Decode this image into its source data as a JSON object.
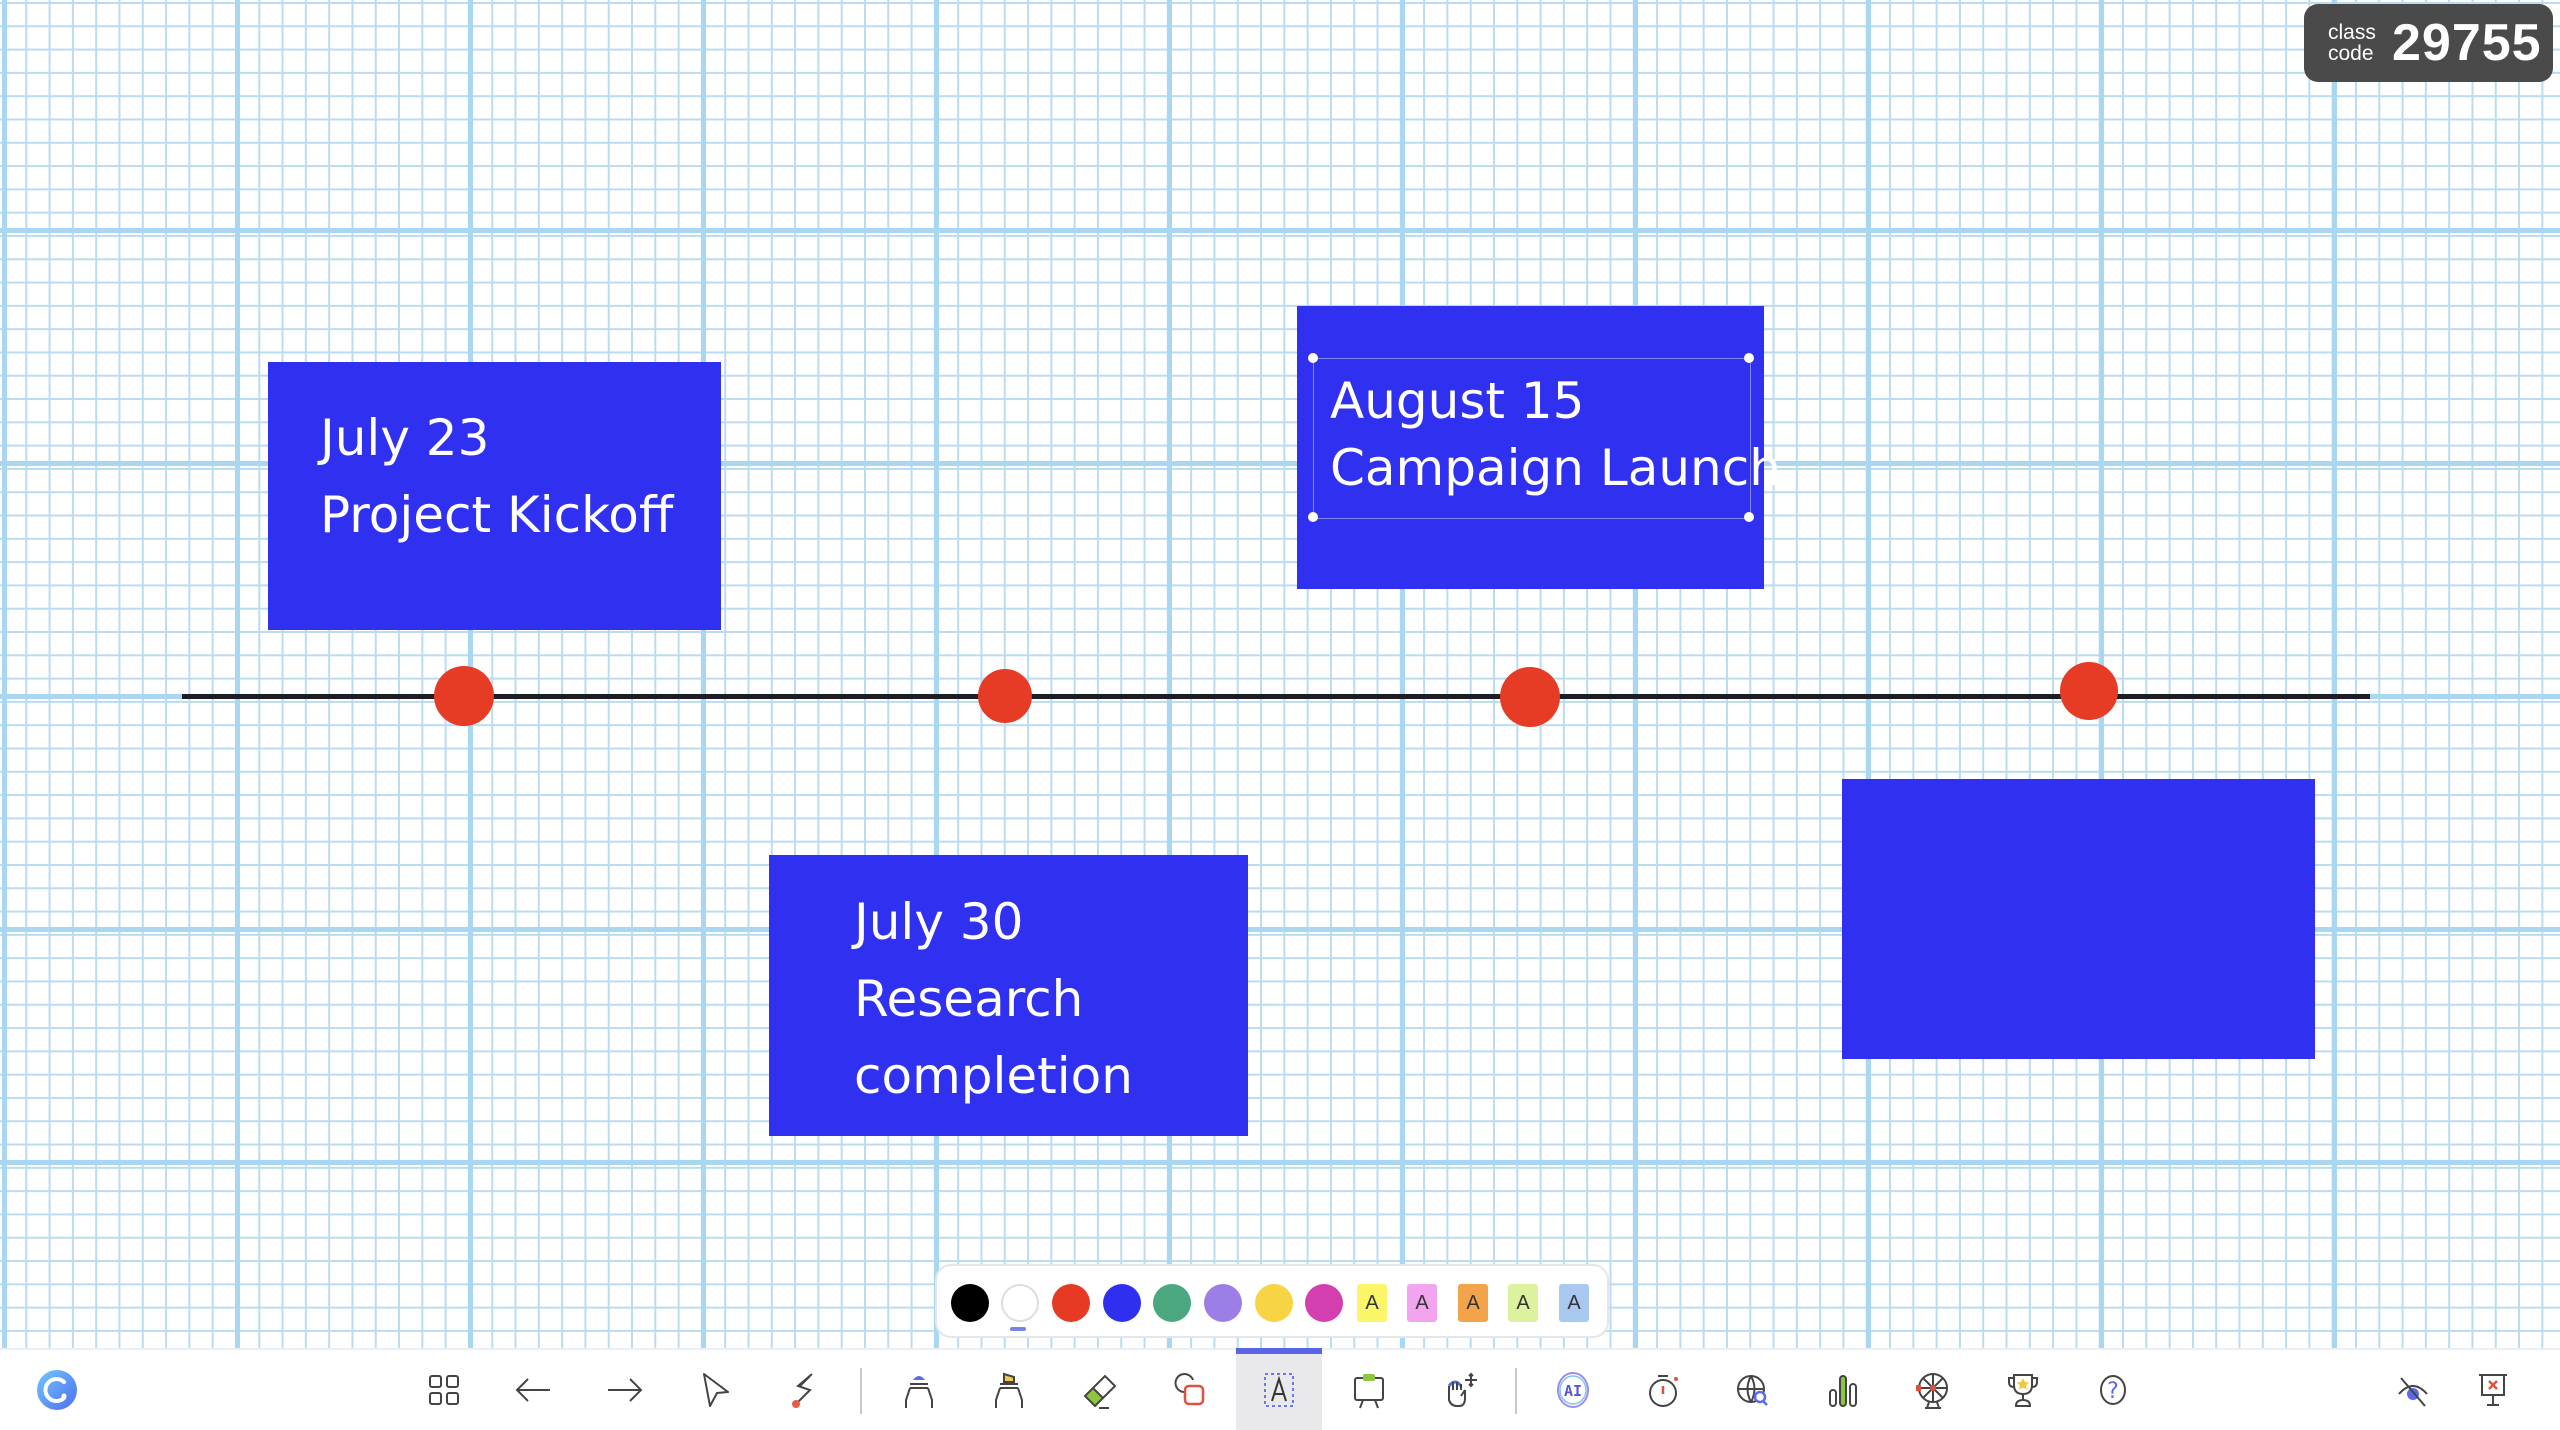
{
  "class_code": {
    "label_line1": "class",
    "label_line2": "code",
    "value": "29755"
  },
  "timeline": {
    "events": [
      {
        "date": "July 23",
        "title": "Project Kickoff"
      },
      {
        "date": "July 30",
        "title_line1": "Research",
        "title_line2": "completion"
      },
      {
        "date": "August 15",
        "title": "Campaign Launch",
        "selected": true
      },
      {
        "date": "",
        "title": ""
      }
    ]
  },
  "colors": {
    "card_fill": "#3030f0",
    "marker": "#e63b25",
    "timeline_line": "#1c1e26",
    "grid": "#a9d6f0"
  },
  "palette": {
    "swatches": [
      {
        "name": "black",
        "color": "#000000"
      },
      {
        "name": "white",
        "color": "#ffffff",
        "selected": true
      },
      {
        "name": "red",
        "color": "#e73a24"
      },
      {
        "name": "blue",
        "color": "#2f2ff0"
      },
      {
        "name": "green",
        "color": "#4aa77f"
      },
      {
        "name": "purple",
        "color": "#9b7fe6"
      },
      {
        "name": "yellow",
        "color": "#f6d443"
      },
      {
        "name": "magenta",
        "color": "#d43fb0"
      }
    ],
    "highlights": [
      {
        "label": "A",
        "color": "#fbf56a"
      },
      {
        "label": "A",
        "color": "#f2a4ee"
      },
      {
        "label": "A",
        "color": "#f3a44b"
      },
      {
        "label": "A",
        "color": "#dcf29e"
      },
      {
        "label": "A",
        "color": "#a9c8ef"
      }
    ]
  },
  "toolbar": {
    "tools": [
      {
        "name": "pages",
        "icon": "grid-icon"
      },
      {
        "name": "undo",
        "icon": "arrow-left-icon"
      },
      {
        "name": "redo",
        "icon": "arrow-right-icon"
      },
      {
        "name": "select",
        "icon": "cursor-icon"
      },
      {
        "name": "laser",
        "icon": "laser-pointer-icon"
      },
      {
        "name": "pen",
        "icon": "pen-icon"
      },
      {
        "name": "highlighter",
        "icon": "highlighter-icon"
      },
      {
        "name": "eraser",
        "icon": "eraser-icon"
      },
      {
        "name": "shapes",
        "icon": "shapes-icon"
      },
      {
        "name": "text",
        "icon": "text-box-icon",
        "active": true
      },
      {
        "name": "whiteboard",
        "icon": "easel-icon"
      },
      {
        "name": "move",
        "icon": "hand-move-icon"
      },
      {
        "name": "ai",
        "icon": "ai-icon",
        "label": "AI"
      },
      {
        "name": "timer",
        "icon": "timer-icon"
      },
      {
        "name": "web-search",
        "icon": "globe-search-icon"
      },
      {
        "name": "poll",
        "icon": "bar-chart-icon"
      },
      {
        "name": "spinner-wheel",
        "icon": "wheel-icon"
      },
      {
        "name": "rewards",
        "icon": "trophy-icon"
      },
      {
        "name": "help",
        "icon": "help-icon",
        "label": "?"
      },
      {
        "name": "hide",
        "icon": "eye-off-icon"
      },
      {
        "name": "end-presentation",
        "icon": "presentation-close-icon"
      }
    ]
  }
}
